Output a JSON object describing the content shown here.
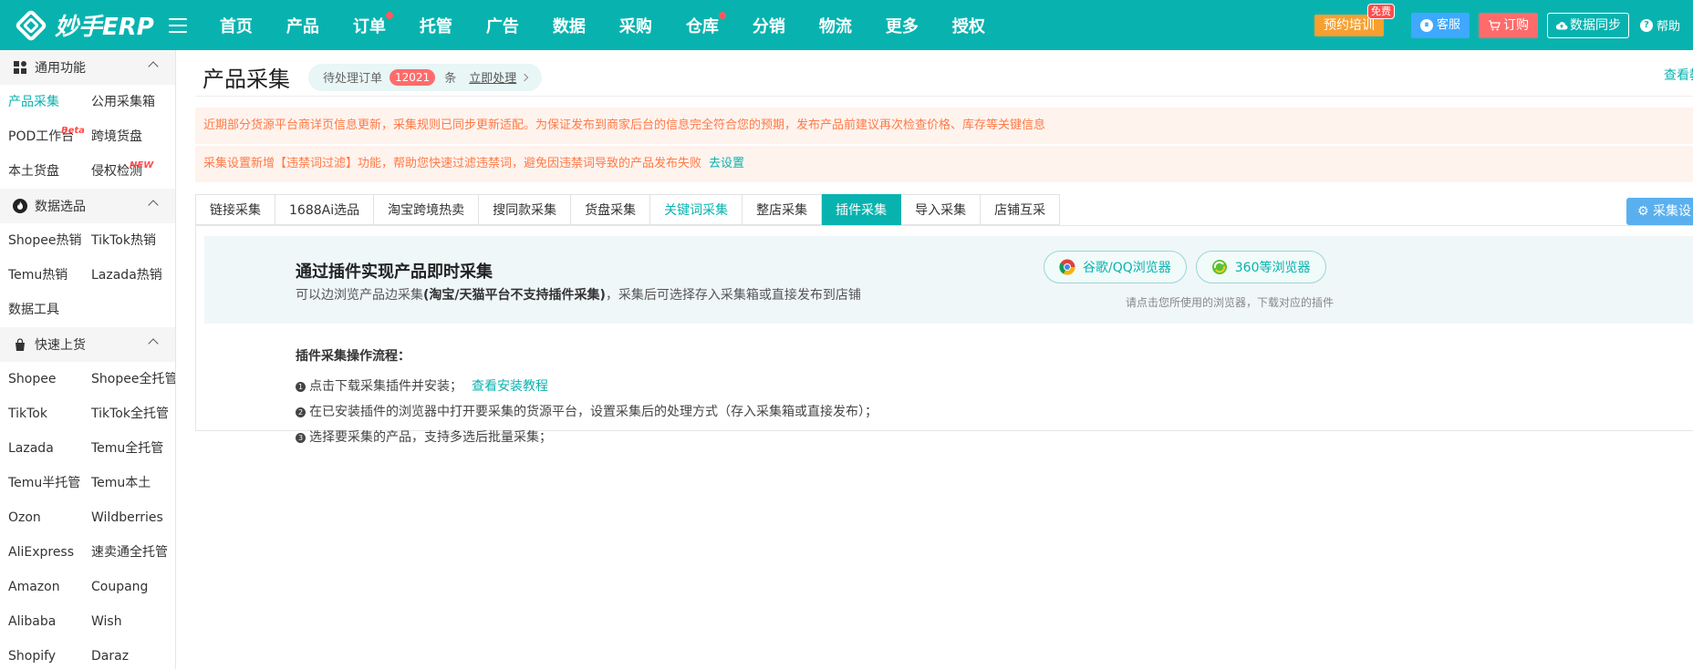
{
  "brand": {
    "logo_text": "妙手ERP"
  },
  "nav": [
    {
      "label": "首页",
      "dot": false
    },
    {
      "label": "产品",
      "dot": false
    },
    {
      "label": "订单",
      "dot": true
    },
    {
      "label": "托管",
      "dot": false
    },
    {
      "label": "广告",
      "dot": false
    },
    {
      "label": "数据",
      "dot": false
    },
    {
      "label": "采购",
      "dot": false
    },
    {
      "label": "仓库",
      "dot": true
    },
    {
      "label": "分销",
      "dot": false
    },
    {
      "label": "物流",
      "dot": false
    },
    {
      "label": "更多",
      "dot": false
    },
    {
      "label": "授权",
      "dot": false
    }
  ],
  "topright": {
    "training": "预约培训",
    "free_badge": "免费",
    "service": "客服",
    "order": "订购",
    "sync": "数据同步",
    "help": "帮助"
  },
  "sidebar": {
    "groups": [
      {
        "title": "通用功能",
        "items": [
          {
            "label": "产品采集",
            "active": true,
            "sup": ""
          },
          {
            "label": "公用采集箱",
            "active": false,
            "sup": ""
          },
          {
            "label": "POD工作台",
            "active": false,
            "sup": "Beta"
          },
          {
            "label": "跨境货盘",
            "active": false,
            "sup": ""
          },
          {
            "label": "本土货盘",
            "active": false,
            "sup": ""
          },
          {
            "label": "侵权检测",
            "active": false,
            "sup": "NEW"
          }
        ]
      },
      {
        "title": "数据选品",
        "items": [
          {
            "label": "Shopee热销",
            "active": false,
            "sup": ""
          },
          {
            "label": "TikTok热销",
            "active": false,
            "sup": ""
          },
          {
            "label": "Temu热销",
            "active": false,
            "sup": ""
          },
          {
            "label": "Lazada热销",
            "active": false,
            "sup": ""
          },
          {
            "label": "数据工具",
            "active": false,
            "sup": ""
          }
        ]
      },
      {
        "title": "快速上货",
        "items": [
          {
            "label": "Shopee",
            "active": false,
            "sup": ""
          },
          {
            "label": "Shopee全托管",
            "active": false,
            "sup": ""
          },
          {
            "label": "TikTok",
            "active": false,
            "sup": ""
          },
          {
            "label": "TikTok全托管",
            "active": false,
            "sup": ""
          },
          {
            "label": "Lazada",
            "active": false,
            "sup": ""
          },
          {
            "label": "Temu全托管",
            "active": false,
            "sup": ""
          },
          {
            "label": "Temu半托管",
            "active": false,
            "sup": ""
          },
          {
            "label": "Temu本土",
            "active": false,
            "sup": ""
          },
          {
            "label": "Ozon",
            "active": false,
            "sup": ""
          },
          {
            "label": "Wildberries",
            "active": false,
            "sup": ""
          },
          {
            "label": "AliExpress",
            "active": false,
            "sup": ""
          },
          {
            "label": "速卖通全托管",
            "active": false,
            "sup": ""
          },
          {
            "label": "Amazon",
            "active": false,
            "sup": ""
          },
          {
            "label": "Coupang",
            "active": false,
            "sup": ""
          },
          {
            "label": "Alibaba",
            "active": false,
            "sup": ""
          },
          {
            "label": "Wish",
            "active": false,
            "sup": ""
          },
          {
            "label": "Shopify",
            "active": false,
            "sup": ""
          },
          {
            "label": "Daraz",
            "active": false,
            "sup": ""
          }
        ]
      }
    ]
  },
  "header": {
    "title": "产品采集",
    "pending_label": "待处理订单",
    "pending_count": "12021",
    "pending_unit": "条",
    "pending_action": "立即处理",
    "view_link": "查看教"
  },
  "notices": [
    {
      "text": "近期部分货源平台商详页信息更新，采集规则已同步更新适配。为保证发布到商家后台的信息完全符合您的预期，发布产品前建议再次检查价格、库存等关键信息",
      "link": ""
    },
    {
      "text": "采集设置新增【违禁词过滤】功能，帮助您快速过滤违禁词，避免因违禁词导致的产品发布失败",
      "link": "去设置"
    }
  ],
  "tabs": [
    {
      "label": "链接采集",
      "state": ""
    },
    {
      "label": "1688Ai选品",
      "state": ""
    },
    {
      "label": "淘宝跨境热卖",
      "state": ""
    },
    {
      "label": "搜同款采集",
      "state": ""
    },
    {
      "label": "货盘采集",
      "state": ""
    },
    {
      "label": "关键词采集",
      "state": "kw"
    },
    {
      "label": "整店采集",
      "state": ""
    },
    {
      "label": "插件采集",
      "state": "active"
    },
    {
      "label": "导入采集",
      "state": ""
    },
    {
      "label": "店铺互采",
      "state": ""
    }
  ],
  "settings_button": "采集设",
  "plugin": {
    "title": "通过插件实现产品即时采集",
    "desc_pre": "可以边浏览产品边采集",
    "desc_bold": "(淘宝/天猫平台不支持插件采集)",
    "desc_post": "，采集后可选择存入采集箱或直接发布到店铺",
    "chrome_btn": "谷歌/QQ浏览器",
    "b360_btn": "360等浏览器",
    "hint": "请点击您所使用的浏览器，下载对应的插件",
    "steps_title": "插件采集操作流程：",
    "steps": [
      {
        "num": "1",
        "text": "点击下载采集插件并安装；",
        "link": "查看安装教程"
      },
      {
        "num": "2",
        "text": "在已安装插件的浏览器中打开要采集的货源平台，设置采集后的处理方式（存入采集箱或直接发布）；",
        "link": ""
      },
      {
        "num": "3",
        "text": "选择要采集的产品，支持多选后批量采集；",
        "link": ""
      }
    ]
  },
  "colors": {
    "brand": "#08b3af",
    "notice_text": "#ff7a45",
    "notice_bg": "#fff3ee",
    "badge_red": "#ff6b6b"
  }
}
